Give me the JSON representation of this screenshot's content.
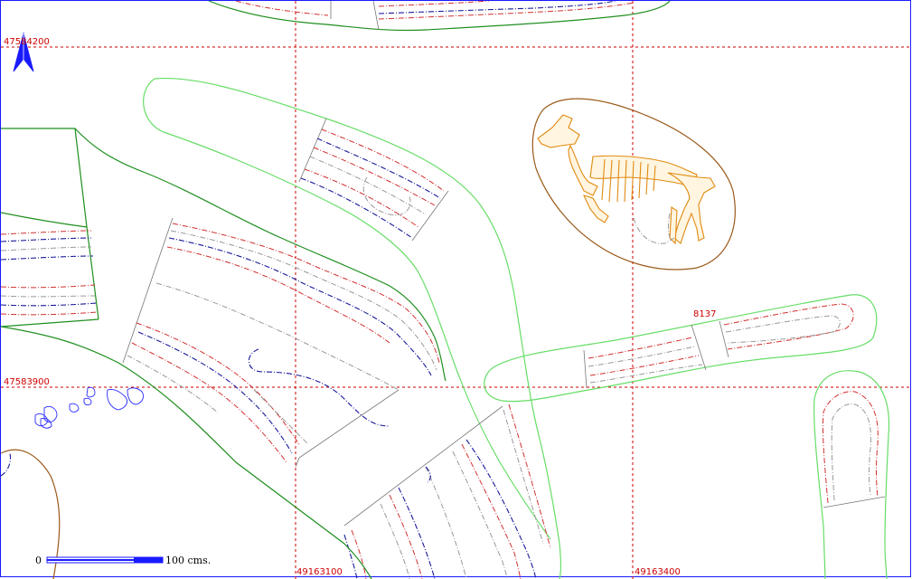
{
  "map": {
    "coord_labels": {
      "y_top": "47584200",
      "y_mid": "47583900",
      "x_left": "49163100",
      "x_right": "49163400"
    },
    "feature_label": "8137",
    "scale_bar": {
      "start_label": "0",
      "end_label": "100 cms."
    },
    "north_arrow": "north-arrow",
    "colors": {
      "grid": "#cc0000",
      "trench_outline": "#66dd66",
      "trench_outline_dark": "#1f8f1f",
      "contour_red": "#d03030",
      "contour_blue": "#1a1a9a",
      "contour_gray": "#999999",
      "pit_outline": "#9a5a1a",
      "skeleton": "#e08a10",
      "stones": "#2a2aff"
    }
  }
}
